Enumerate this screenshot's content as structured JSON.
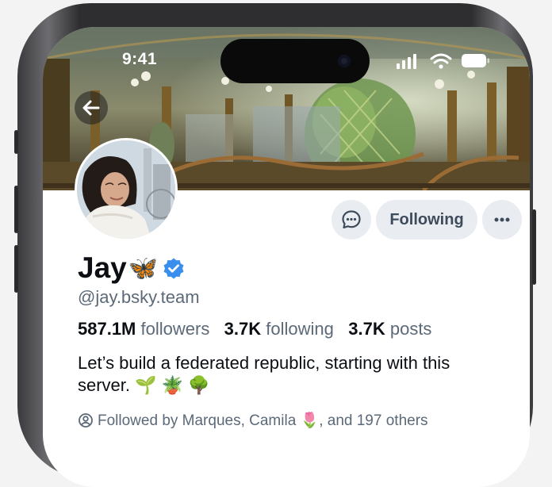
{
  "status_bar": {
    "time": "9:41"
  },
  "profile": {
    "name": "Jay",
    "name_emoji": "🦋",
    "verified": true,
    "handle": "@jay.bsky.team",
    "followers_count": "587.1M",
    "followers_label": "followers",
    "following_count": "3.7K",
    "following_label": "following",
    "posts_count": "3.7K",
    "posts_label": "posts",
    "bio": "Let’s build a federated republic, starting with this server. 🌱 🪴 🌳",
    "followed_by": "Followed by Marques, Camila 🌷, and 197 others"
  },
  "actions": {
    "follow_label": "Following"
  },
  "icons": {
    "back": "back-arrow-icon",
    "message": "chat-bubble-icon",
    "more": "more-dots-icon",
    "verified": "verified-check-icon",
    "followed_by": "person-circle-icon"
  },
  "colors": {
    "accent": "#3a8eed",
    "button_bg": "#e9edf2",
    "muted_text": "#5b6978"
  }
}
